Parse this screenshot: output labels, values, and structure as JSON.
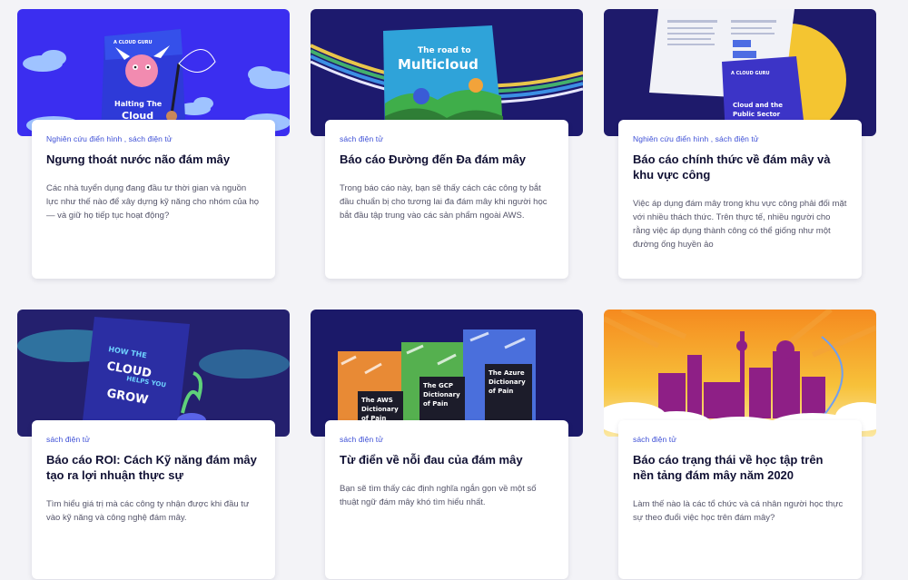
{
  "cards": [
    {
      "tag": "Nghiên cứu điển hình , sách điện tử",
      "title": "Ngưng thoát nước não đám mây",
      "desc": "Các nhà tuyển dụng đang đầu tư thời gian và nguồn lực như thế nào để xây dựng kỹ năng cho nhóm của họ — và giữ họ tiếp tục hoạt động?",
      "art_text_1": "Halting The",
      "art_text_2": "Cloud",
      "art_brand": "A CLOUD GURU"
    },
    {
      "tag": "sách điện tử",
      "title": "Báo cáo Đường đến Đa đám mây",
      "desc": "Trong báo cáo này, bạn sẽ thấy cách các công ty bắt đầu chuẩn bị cho tương lai đa đám mây khi người học bắt đầu tập trung vào các sản phẩm ngoài AWS.",
      "art_text_1": "The road to",
      "art_text_2": "Multicloud"
    },
    {
      "tag": "Nghiên cứu điển hình , sách điện tử",
      "title": "Báo cáo chính thức về đám mây và khu vực công",
      "desc": "Việc áp dụng đám mây trong khu vực công phải đối mặt với nhiều thách thức. Trên thực tế, nhiều người cho rằng việc áp dụng thành công có thể giống như một đường ống huyền ảo",
      "art_brand": "A CLOUD GURU",
      "art_text_1": "Cloud and the",
      "art_text_2": "Public Sector"
    },
    {
      "tag": "sách điện tử",
      "title": "Báo cáo ROI: Cách Kỹ năng đám mây tạo ra lợi nhuận thực sự",
      "desc": "Tìm hiểu giá trị mà các công ty nhận được khi đầu tư vào kỹ năng và công nghệ đám mây.",
      "art_text_1": "HOW THE",
      "art_text_2": "CLOUD",
      "art_text_3": "HELPS YOU",
      "art_text_4": "GROW"
    },
    {
      "tag": "sách điện tử",
      "title": "Từ điển về nỗi đau của đám mây",
      "desc": "Bạn sẽ tìm thấy các định nghĩa ngắn gọn về một số thuật ngữ đám mây khó tìm hiểu nhất.",
      "book1": [
        "The AWS",
        "Dictionary",
        "of Pain"
      ],
      "book2": [
        "The GCP",
        "Dictionary",
        "of Pain"
      ],
      "book3": [
        "The Azure",
        "Dictionary",
        "of Pain"
      ]
    },
    {
      "tag": "sách điện tử",
      "title": "Báo cáo trạng thái về học tập trên nền tảng đám mây năm 2020",
      "desc": "Làm thế nào là các tổ chức và cá nhân người học thực sự theo đuổi việc học trên đám mây?"
    }
  ]
}
